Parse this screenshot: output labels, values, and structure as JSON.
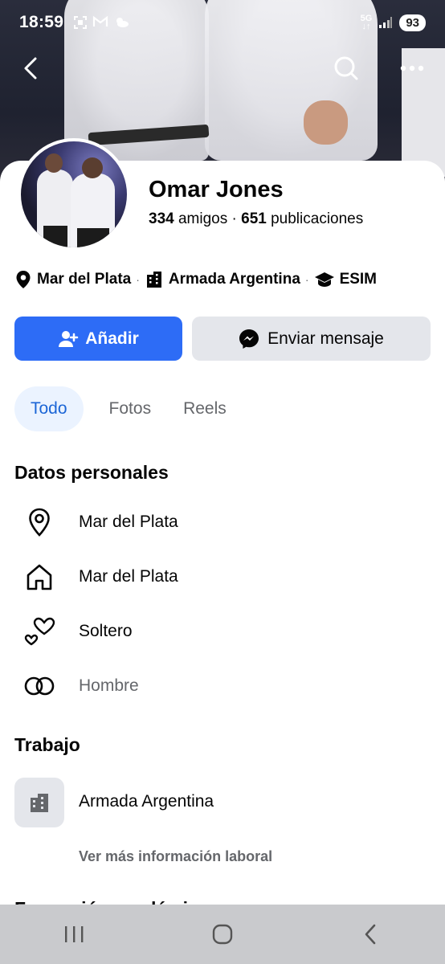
{
  "status_bar": {
    "time": "18:59",
    "left_icons": [
      "screenshot-icon",
      "gmail-icon",
      "weather-icon"
    ],
    "network": "5G",
    "battery": "93"
  },
  "profile": {
    "name": "Omar Jones",
    "friends_count": "334",
    "friends_label": "amigos",
    "separator": "·",
    "posts_count": "651",
    "posts_label": "publicaciones"
  },
  "info_row": {
    "location": "Mar del Plata",
    "work": "Armada Argentina",
    "education": "ESIM",
    "dot": "·"
  },
  "actions": {
    "add_label": "Añadir",
    "message_label": "Enviar mensaje"
  },
  "tabs": [
    {
      "label": "Todo",
      "active": true
    },
    {
      "label": "Fotos",
      "active": false
    },
    {
      "label": "Reels",
      "active": false
    }
  ],
  "personal": {
    "title": "Datos personales",
    "items": [
      {
        "icon": "location-pin-icon",
        "text": "Mar del Plata"
      },
      {
        "icon": "home-icon",
        "text": "Mar del Plata"
      },
      {
        "icon": "hearts-icon",
        "text": "Soltero"
      },
      {
        "icon": "rings-icon",
        "text": "Hombre"
      }
    ]
  },
  "work": {
    "title": "Trabajo",
    "employer": "Armada Argentina",
    "more_label": "Ver más información laboral"
  },
  "next_section_title": "Formación académica",
  "colors": {
    "primary": "#2d6cf6",
    "tab_active_bg": "#ebf3ff",
    "tab_active_text": "#1b65d6",
    "secondary_btn": "#e4e6eb",
    "muted_text": "#65676b",
    "navbar_bg": "#c9cacd"
  }
}
